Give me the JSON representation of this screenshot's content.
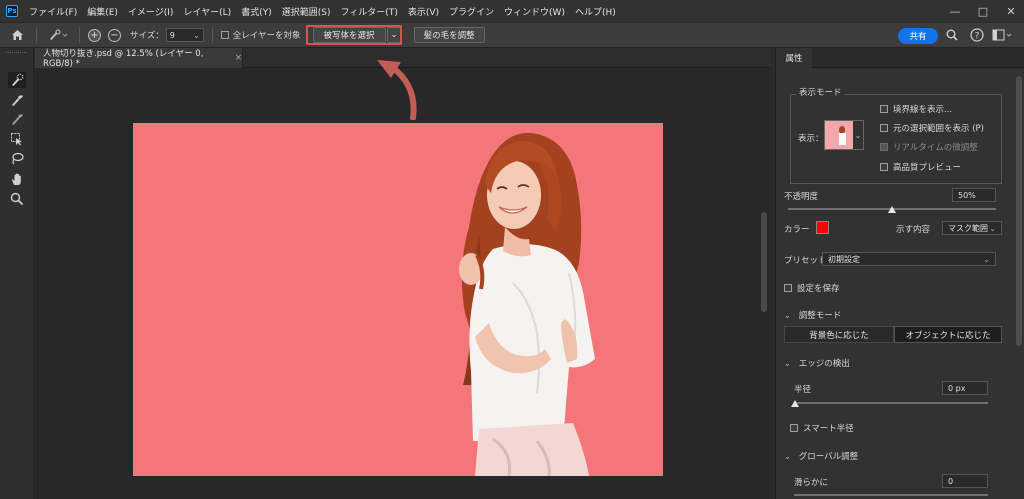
{
  "menubar": {
    "logo": "Ps",
    "items": [
      "ファイル(F)",
      "編集(E)",
      "イメージ(I)",
      "レイヤー(L)",
      "書式(Y)",
      "選択範囲(S)",
      "フィルター(T)",
      "表示(V)",
      "プラグイン",
      "ウィンドウ(W)",
      "ヘルプ(H)"
    ],
    "window_controls": [
      "—",
      "□",
      "✕"
    ]
  },
  "options": {
    "size_label": "サイズ：",
    "size_value": "9",
    "all_layers_label": "全レイヤーを対象",
    "select_subject_label": "被写体を選択",
    "refine_hair_label": "髪の毛を調整",
    "share_label": "共有"
  },
  "document": {
    "tab_title": "人物切り抜き.psd @ 12.5% (レイヤー 0, RGB/8) *",
    "tab_close": "×",
    "canvas_color": "#f5767a",
    "highlight_color": "#d9534f"
  },
  "panel": {
    "tab_label": "属性",
    "view_mode_title": "表示モード",
    "view_label": "表示：",
    "show_edge": "境界線を表示...",
    "show_original": "元の選択範囲を表示 (P)",
    "realtime_refine": "リアルタイムの微調整",
    "hq_preview": "高品質プレビュー",
    "opacity_label": "不透明度",
    "opacity_value": "50%",
    "opacity_fraction": 0.5,
    "color_label": "カラー",
    "color_swatch": "#ff0000",
    "indicates_label": "示す内容",
    "indicates_value": "マスク範囲",
    "preset_label": "プリセット",
    "preset_value": "初期設定",
    "save_settings": "設定を保存",
    "refine_mode_title": "調整モード",
    "mode_color_aware": "背景色に応じた",
    "mode_object_aware": "オブジェクトに応じた",
    "edge_detection_title": "エッジの検出",
    "radius_label": "半径",
    "radius_value": "0 px",
    "smart_radius_label": "スマート半径",
    "global_refine_title": "グローバル調整",
    "smooth_label": "滑らかに",
    "smooth_value": "0"
  }
}
